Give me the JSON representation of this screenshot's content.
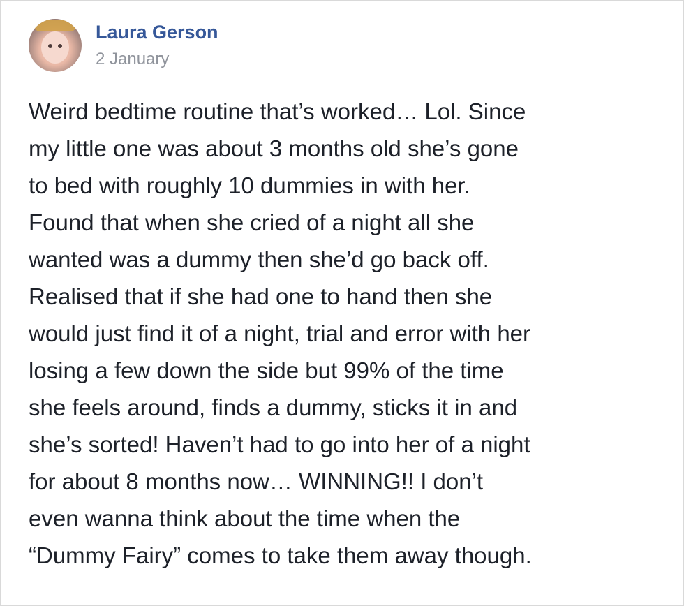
{
  "post": {
    "author": "Laura Gerson",
    "date": "2 January",
    "lines": [
      "Weird bedtime routine that’s worked… Lol. Since",
      "my little one was about 3 months old she’s gone",
      "to bed with roughly 10 dummies in with her.",
      "Found that when she cried of a night all she",
      "wanted was a dummy then she’d go back off.",
      "Realised that if she had one to hand then she",
      "would just find it of a night, trial and error with her",
      "losing a few down the side but 99% of the time",
      "she feels around, finds a dummy, sticks it in and",
      "she’s sorted! Haven’t had to go into her of a night",
      "for about 8 months now… WINNING!! I don’t",
      "even wanna think about the time when the",
      "“Dummy Fairy” comes to take them away though."
    ]
  },
  "colors": {
    "author": "#365899",
    "date": "#90949c",
    "text": "#1d2129",
    "border": "#d9d9d9"
  }
}
